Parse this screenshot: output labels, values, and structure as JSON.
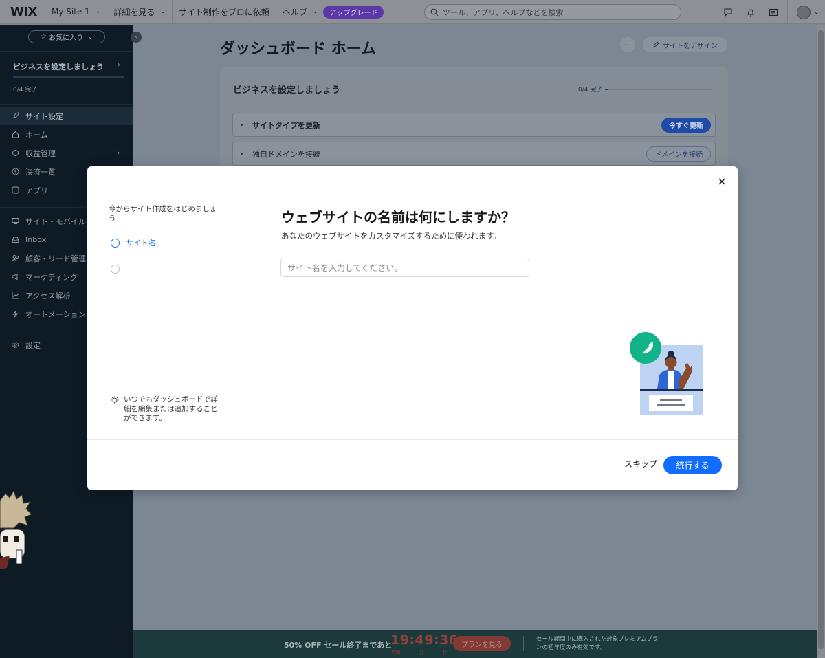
{
  "topbar": {
    "logo": "WIX",
    "site_name": "My Site 1",
    "menu": [
      "詳細を見る",
      "サイト制作をプロに依頼",
      "ヘルプ"
    ],
    "upgrade_label": "アップグレード",
    "search_placeholder": "ツール、アプリ、ヘルプなどを検索",
    "icons": [
      "chat-icon",
      "bell-icon",
      "layout-icon",
      "avatar"
    ]
  },
  "sidebar": {
    "favorites_label": "お気に入り",
    "setup": {
      "title": "ビジネスを設定しましょう",
      "progress_label": "0/4 完了",
      "progress": 0.02
    },
    "items": [
      {
        "label": "サイト設定",
        "icon": "rocket-icon",
        "active": true
      },
      {
        "label": "ホーム",
        "icon": "home-icon"
      },
      {
        "label": "収益管理",
        "icon": "coin-icon",
        "has_children": true
      },
      {
        "label": "決済一覧",
        "icon": "dollar-icon"
      },
      {
        "label": "アプリ",
        "icon": "apps-icon"
      },
      {
        "label": "サイト・モバイルアプリ",
        "icon": "monitor-icon"
      },
      {
        "label": "Inbox",
        "icon": "inbox-icon"
      },
      {
        "label": "顧客・リード管理",
        "icon": "people-icon"
      },
      {
        "label": "マーケティング",
        "icon": "megaphone-icon"
      },
      {
        "label": "アクセス解析",
        "icon": "chart-icon"
      },
      {
        "label": "オートメーション",
        "icon": "bolt-icon"
      },
      {
        "label": "設定",
        "icon": "gear-icon"
      }
    ]
  },
  "dashboard": {
    "title": "ダッシュボード ホーム",
    "more_label": "···",
    "design_button": "サイトをデザイン",
    "setup_card": {
      "title": "ビジネスを設定しましょう",
      "progress_label": "0/4 完了",
      "rows": [
        {
          "label": "サイトタイプを更新",
          "button": "今すぐ更新"
        },
        {
          "label": "独自ドメインを接続",
          "button": "ドメインを接続"
        }
      ]
    }
  },
  "promo": {
    "text": "50% OFF セール終了まであと",
    "timer": "19:49:36",
    "timer_units": [
      "時間",
      "分",
      "秒"
    ],
    "plan_button": "プランを見る",
    "note": "セール期間中に購入された対象プレミアムプランの初年度のみ有効です。"
  },
  "modal": {
    "intro": "今からサイト作成をはじめましょう",
    "steps": [
      "サイト名",
      ""
    ],
    "tip": "いつでもダッシュボードで詳細を編集または追加することができます。",
    "question": "ウェブサイトの名前は何にしますか？",
    "subtitle": "あなたのウェブサイトをカスタマイズするために使われます。",
    "input_value": "",
    "input_placeholder": "サイト名を入力してください。",
    "skip_label": "スキップ",
    "continue_label": "続行する",
    "accent_color": "#116dff"
  }
}
